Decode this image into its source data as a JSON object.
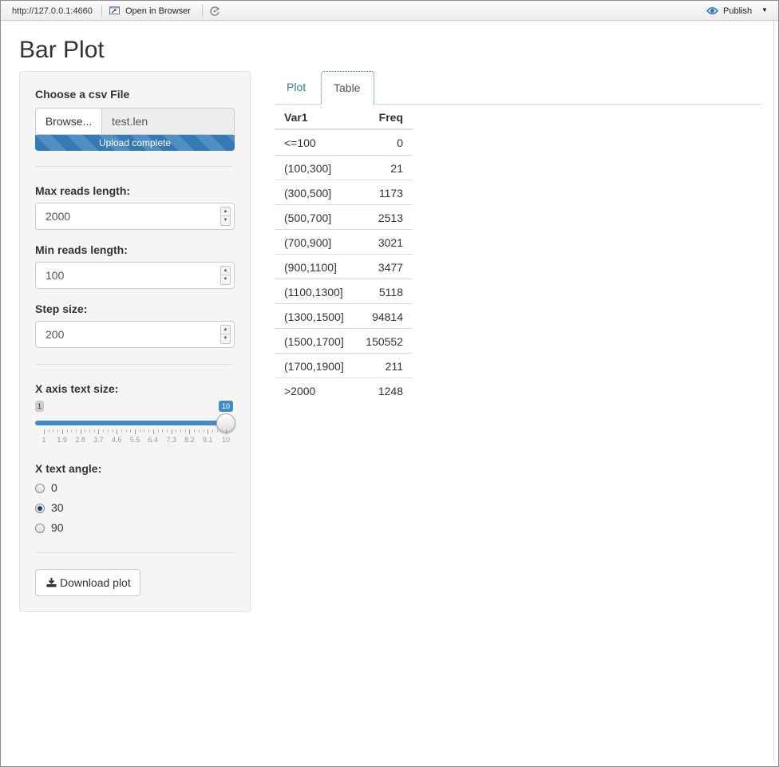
{
  "toolbar": {
    "url": "http://127.0.0.1:4660",
    "open_browser_label": "Open in Browser",
    "publish_label": "Publish"
  },
  "page": {
    "title": "Bar Plot"
  },
  "sidebar": {
    "file": {
      "label": "Choose a csv File",
      "browse_label": "Browse...",
      "filename": "test.len",
      "progress_label": "Upload complete",
      "progress_value": 1.0
    },
    "max_reads": {
      "label": "Max reads length:",
      "value": "2000"
    },
    "min_reads": {
      "label": "Min reads length:",
      "value": "100"
    },
    "step_size": {
      "label": "Step size:",
      "value": "200"
    },
    "x_text_size": {
      "label": "X axis text size:",
      "min": "1",
      "max": "10",
      "value": "10",
      "tick_labels": [
        "1",
        "1.9",
        "2.8",
        "3.7",
        "4.6",
        "5.5",
        "6.4",
        "7.3",
        "8.2",
        "9.1",
        "10"
      ]
    },
    "x_text_angle": {
      "label": "X text angle:",
      "options": [
        "0",
        "30",
        "90"
      ],
      "selected": "30"
    },
    "download_label": "Download plot"
  },
  "tabs": [
    {
      "label": "Plot",
      "active": false
    },
    {
      "label": "Table",
      "active": true
    }
  ],
  "table": {
    "headers": [
      "Var1",
      "Freq"
    ],
    "rows": [
      [
        "<=100",
        "0"
      ],
      [
        "(100,300]",
        "21"
      ],
      [
        "(300,500]",
        "1173"
      ],
      [
        "(500,700]",
        "2513"
      ],
      [
        "(700,900]",
        "3021"
      ],
      [
        "(900,1100]",
        "3477"
      ],
      [
        "(1100,1300]",
        "5118"
      ],
      [
        "(1300,1500]",
        "94814"
      ],
      [
        "(1500,1700]",
        "150552"
      ],
      [
        "(1700,1900]",
        "211"
      ],
      [
        ">2000",
        "1248"
      ]
    ]
  },
  "colors": {
    "accent": "#337ab7",
    "slider": "#428bca",
    "radio_checked": "#1b3c6b"
  }
}
